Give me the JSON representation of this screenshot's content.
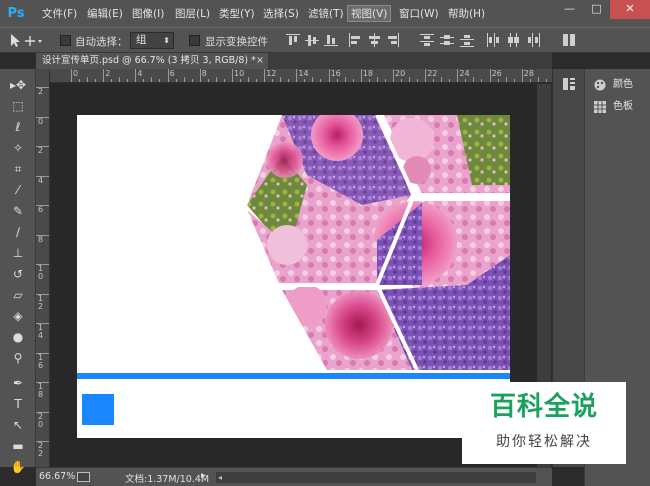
{
  "app": {
    "logo": "Ps"
  },
  "menubar": {
    "items": [
      "文件(F)",
      "编辑(E)",
      "图像(I)",
      "图层(L)",
      "类型(Y)",
      "选择(S)",
      "滤镜(T)",
      "视图(V)",
      "窗口(W)",
      "帮助(H)"
    ],
    "active": "视图(V)",
    "window_controls": {
      "minimize": "—",
      "restore": "□",
      "close": "✕"
    }
  },
  "optionsbar": {
    "auto_select_label": "自动选择：",
    "auto_select_value": "组",
    "show_transform_label": "显示变换控件"
  },
  "document_tab": {
    "title": "设计宣传单页.psd @ 66.7% (3 拷贝 3, RGB/8) *",
    "close": "×"
  },
  "rulers": {
    "top": [
      "0",
      "2",
      "4",
      "6",
      "8",
      "10",
      "12",
      "14",
      "16",
      "18",
      "20",
      "22",
      "24",
      "26",
      "28"
    ],
    "left": [
      "2",
      "0",
      "2",
      "4",
      "6",
      "8",
      "1\n0",
      "1\n2",
      "1\n4",
      "1\n6",
      "1\n8",
      "2\n0",
      "2\n2",
      "2\n4"
    ]
  },
  "toolbar": {
    "tools": [
      {
        "name": "move-tool",
        "icon": "move-icon",
        "glyph": "▸✥"
      },
      {
        "name": "marquee-tool",
        "icon": "marquee-icon",
        "glyph": "⬚"
      },
      {
        "name": "lasso-tool",
        "icon": "lasso-icon",
        "glyph": "ℓ"
      },
      {
        "name": "magic-wand-tool",
        "icon": "magic-wand-icon",
        "glyph": "✧"
      },
      {
        "name": "crop-tool",
        "icon": "crop-icon",
        "glyph": "⌗"
      },
      {
        "name": "eyedropper-tool",
        "icon": "eyedropper-icon",
        "glyph": "⁄"
      },
      {
        "name": "healing-brush-tool",
        "icon": "bandage-icon",
        "glyph": "✎"
      },
      {
        "name": "brush-tool",
        "icon": "brush-icon",
        "glyph": "∕"
      },
      {
        "name": "clone-stamp-tool",
        "icon": "stamp-icon",
        "glyph": "⊥"
      },
      {
        "name": "history-brush-tool",
        "icon": "history-brush-icon",
        "glyph": "↺"
      },
      {
        "name": "eraser-tool",
        "icon": "eraser-icon",
        "glyph": "▱"
      },
      {
        "name": "paint-bucket-tool",
        "icon": "bucket-icon",
        "glyph": "◈"
      },
      {
        "name": "blur-tool",
        "icon": "drop-icon",
        "glyph": "●"
      },
      {
        "name": "dodge-tool",
        "icon": "dodge-icon",
        "glyph": "⚲"
      },
      {
        "name": "pen-tool",
        "icon": "pen-icon",
        "glyph": "✒"
      },
      {
        "name": "type-tool",
        "icon": "type-icon",
        "glyph": "T"
      },
      {
        "name": "path-selection-tool",
        "icon": "path-select-icon",
        "glyph": "↖"
      },
      {
        "name": "rectangle-tool",
        "icon": "rectangle-icon",
        "glyph": "▬"
      },
      {
        "name": "hand-tool",
        "icon": "hand-icon",
        "glyph": "✋"
      }
    ]
  },
  "statusbar": {
    "zoom": "66.67%",
    "doc_info": "文档:1.37M/10.4M"
  },
  "dock": {
    "panels": [
      {
        "label": "颜色",
        "icon": "palette-icon"
      },
      {
        "label": "色板",
        "icon": "swatches-icon"
      }
    ]
  },
  "watermark": {
    "title": "百科全说",
    "subtitle": "助你轻松解决"
  },
  "colors": {
    "accent_blue": "#1a86ff",
    "watermark_green": "#1aa160"
  }
}
